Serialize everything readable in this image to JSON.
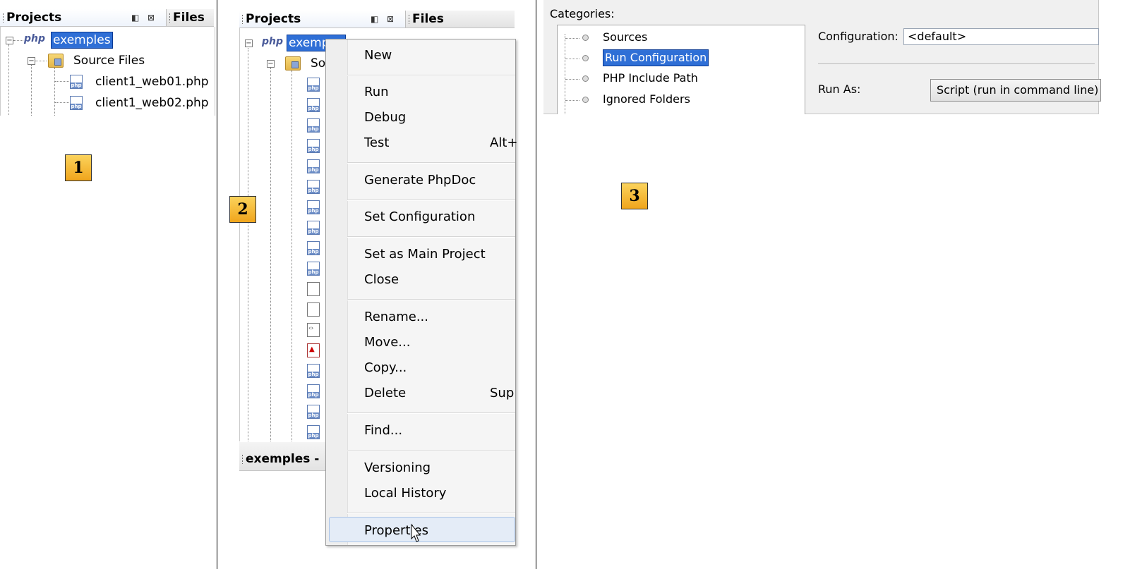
{
  "panel1": {
    "tabs": {
      "projects": "Projects",
      "files": "Files"
    },
    "project_name": "exemples",
    "source_files": "Source Files",
    "files": [
      "client1_web01.php",
      "client1_web02.php"
    ],
    "marker": "1"
  },
  "panel2": {
    "tabs": {
      "projects": "Projects",
      "files": "Files"
    },
    "project_name": "exemp",
    "source_partial": "So",
    "bottom_tab": "exemples -",
    "marker": "2",
    "menu": {
      "new": "New",
      "run": "Run",
      "debug": "Debug",
      "test": "Test",
      "test_shortcut": "Alt+",
      "generate_phpdoc": "Generate PhpDoc",
      "set_configuration": "Set Configuration",
      "set_main_project": "Set as Main Project",
      "close": "Close",
      "rename": "Rename...",
      "move": "Move...",
      "copy": "Copy...",
      "delete": "Delete",
      "delete_shortcut": "Sup",
      "find": "Find...",
      "versioning": "Versioning",
      "local_history": "Local History",
      "properties": "Properties"
    }
  },
  "panel3": {
    "categories_label": "Categories:",
    "categories": [
      "Sources",
      "Run Configuration",
      "PHP Include Path",
      "Ignored Folders"
    ],
    "selected_category": "Run Configuration",
    "configuration_label": "Configuration:",
    "configuration_value": "<default>",
    "run_as_label": "Run As:",
    "run_as_value": "Script (run in command line)",
    "marker": "3"
  },
  "colors": {
    "selection": "#2f6fd6",
    "marker": "#f0a51c"
  },
  "icons": [
    "php-project-icon",
    "source-folder-icon",
    "php-file-icon",
    "plain-file-icon",
    "pdf-file-icon",
    "xml-file-icon",
    "mouse-cursor-icon"
  ]
}
